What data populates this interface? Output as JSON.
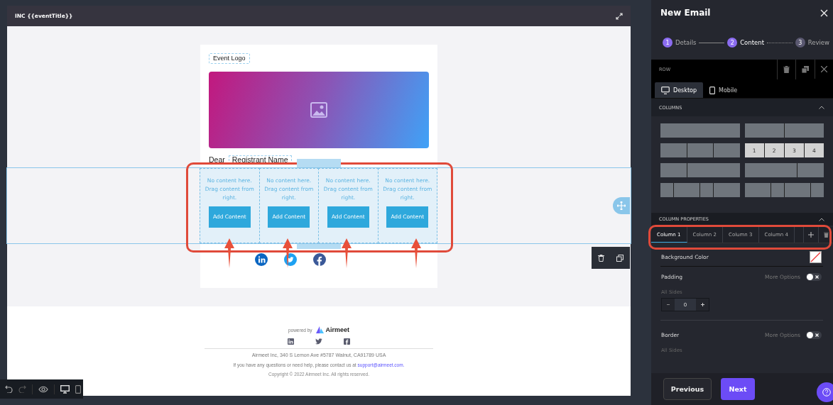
{
  "editor": {
    "title": "INC {{eventTitle}}"
  },
  "email": {
    "logo_label": "Event Logo",
    "greeting": "Dear",
    "name_tag": "Registrant Name",
    "columns": [
      {
        "message": "No content here. Drag content from right.",
        "button": "Add Content"
      },
      {
        "message": "No content here. Drag content from right.",
        "button": "Add Content"
      },
      {
        "message": "No content here. Drag content from right.",
        "button": "Add Content"
      },
      {
        "message": "No content here. Drag content from right.",
        "button": "Add Content"
      }
    ],
    "social": [
      {
        "kind": "linkedin"
      },
      {
        "kind": "twitter"
      },
      {
        "kind": "facebook"
      }
    ]
  },
  "footer": {
    "powered_by": "powered by",
    "brand": "Airmeet",
    "social": [
      {
        "kind": "linkedin"
      },
      {
        "kind": "twitter"
      },
      {
        "kind": "facebook"
      }
    ],
    "address": "Airmeet Inc, 340 S Lemon Ave #5787 Walnut, CA91789 USA",
    "help_text": "If you have any questions or need help, please contact us at",
    "help_link": "support@airmeet.com.",
    "copyright": "Copyright © 2022 Airmeet Inc. All rights reserved."
  },
  "panel": {
    "title": "New Email",
    "steps": [
      {
        "number": "1",
        "label": "Details",
        "kind": "done"
      },
      {
        "number": "2",
        "label": "Content",
        "kind": "current"
      },
      {
        "number": "3",
        "label": "Review",
        "kind": "upcoming"
      }
    ],
    "section_label": "ROW",
    "view_tabs": [
      {
        "label": "Desktop",
        "kind": "desktop",
        "selected": true
      },
      {
        "label": "Mobile",
        "kind": "mobile",
        "selected": false
      }
    ],
    "columns_header": "COLUMNS",
    "layouts": [
      {
        "kind": "full",
        "selected": false
      },
      {
        "kind": "halves",
        "selected": false
      },
      {
        "kind": "thirds",
        "selected": false
      },
      {
        "kind": "quarters",
        "selected": true,
        "labels": [
          "1",
          "2",
          "3",
          "4"
        ]
      },
      {
        "kind": "narrowwide",
        "selected": false
      },
      {
        "kind": "widenarrow",
        "selected": false
      },
      {
        "kind": "mixeda",
        "selected": false
      },
      {
        "kind": "mixedb",
        "selected": false
      }
    ],
    "properties_header": "COLUMN PROPERTIES",
    "column_tabs": [
      {
        "label": "Column 1",
        "selected": true
      },
      {
        "label": "Column 2",
        "selected": false
      },
      {
        "label": "Column 3",
        "selected": false
      },
      {
        "label": "Column 4",
        "selected": false
      }
    ],
    "background_label": "Background Color",
    "padding": {
      "label": "Padding",
      "more": "More Options",
      "on": false,
      "sides_label": "All Sides",
      "value": "0"
    },
    "border": {
      "label": "Border",
      "more": "More Options",
      "on": false,
      "sides_label": "All Sides"
    },
    "previous": "Previous",
    "next": "Next"
  }
}
